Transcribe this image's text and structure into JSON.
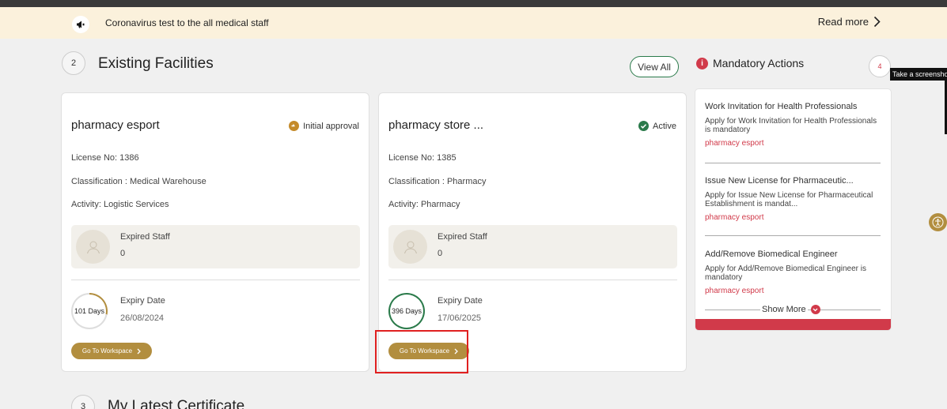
{
  "announcement": {
    "text": "Coronavirus test to the all medical staff",
    "read_more": "Read more"
  },
  "facilities": {
    "count": "2",
    "title": "Existing Facilities",
    "view_all": "View All",
    "cards": [
      {
        "name": "pharmacy esport",
        "status": "Initial approval",
        "license": "License No:  1386",
        "classification": "Classification :  Medical Warehouse",
        "activity": "Activity:  Logistic Services",
        "expired_staff_label": "Expired Staff",
        "expired_staff_count": "0",
        "days": "101 Days",
        "expiry_label": "Expiry Date",
        "expiry_date": "26/08/2024",
        "goto": "Go To Workspace",
        "days_progress": 0.28
      },
      {
        "name": "pharmacy store ...",
        "status": "Active",
        "license": "License No:  1385",
        "classification": "Classification :  Pharmacy",
        "activity": "Activity:  Pharmacy",
        "expired_staff_label": "Expired Staff",
        "expired_staff_count": "0",
        "days": "396 Days",
        "expiry_label": "Expiry Date",
        "expiry_date": "17/06/2025",
        "goto": "Go To Workspace",
        "days_progress": 1.0
      }
    ]
  },
  "mandatory": {
    "title": "Mandatory Actions",
    "count": "4",
    "items": [
      {
        "title": "Work Invitation for Health Professionals",
        "desc": "Apply for Work Invitation for Health Professionals is mandatory",
        "facility": "pharmacy esport"
      },
      {
        "title": "Issue New License for Pharmaceutic...",
        "desc": "Apply for Issue New License for Pharmaceutical Establishment is mandat...",
        "facility": "pharmacy esport"
      },
      {
        "title": "Add/Remove Biomedical Engineer",
        "desc": "Apply for Add/Remove Biomedical Engineer is mandatory",
        "facility": "pharmacy esport"
      }
    ],
    "show_more": "Show More"
  },
  "certificates": {
    "count": "3",
    "title": "My Latest Certificate"
  },
  "tooltip": "Take a screenshot",
  "colors": {
    "gold": "#b28e3f",
    "red": "#d13a4a",
    "green": "#2a7a4a",
    "banner": "#fbf1dc"
  }
}
